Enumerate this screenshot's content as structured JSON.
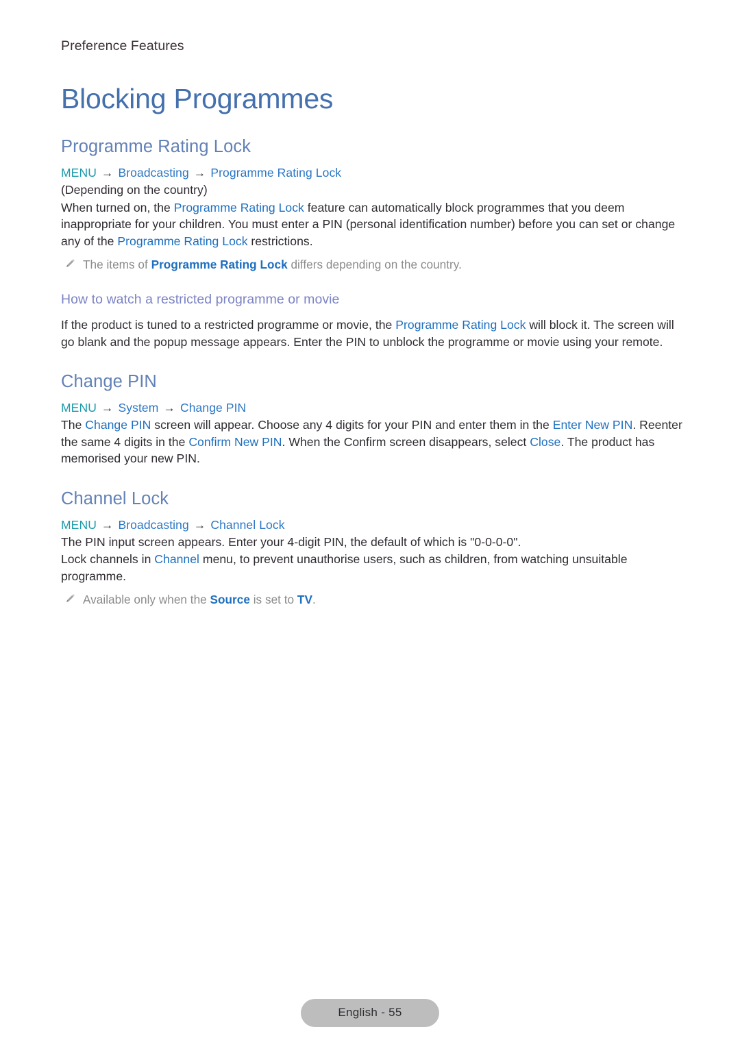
{
  "document": {
    "running_header": "Preference Features",
    "chapter_title": "Blocking Programmes",
    "page_badge": "English - 55"
  },
  "colors": {
    "chapter_title": "#4470ad",
    "section_title": "#6281b6",
    "subsection_title": "#7b83c4",
    "menu_root": "#1b9aaa",
    "menu_item": "#2a76c4",
    "inline_link": "#1d6fc0",
    "body_text": "#2f2b31",
    "note_text": "#8b8b8b",
    "badge_background": "#bdbdbd",
    "page_background": "#ffffff"
  },
  "icons": {
    "note": "pencil-icon",
    "arrow": "→"
  },
  "sections": [
    {
      "id": "programme-rating-lock",
      "title": "Programme Rating Lock",
      "menu_path": {
        "root": "MENU",
        "items": [
          "Broadcasting",
          "Programme Rating Lock"
        ]
      },
      "paragraphs": [
        {
          "id": "depending-country",
          "runs": [
            {
              "t": "(Depending on the country)",
              "s": "plain"
            }
          ]
        },
        {
          "id": "rating-lock-description",
          "runs": [
            {
              "t": "When turned on, the ",
              "s": "plain"
            },
            {
              "t": "Programme Rating Lock",
              "s": "link"
            },
            {
              "t": " feature can automatically block programmes that you deem inappropriate for your children. You must enter a PIN (personal identification number) before you can set or change any of the ",
              "s": "plain"
            },
            {
              "t": "Programme Rating Lock",
              "s": "link"
            },
            {
              "t": " restrictions.",
              "s": "plain"
            }
          ]
        }
      ],
      "notes": [
        {
          "id": "items-differ-note",
          "runs": [
            {
              "t": "The items of ",
              "s": "plain"
            },
            {
              "t": "Programme Rating Lock",
              "s": "link-bold"
            },
            {
              "t": " differs depending on the country.",
              "s": "plain"
            }
          ]
        }
      ],
      "subsections": [
        {
          "id": "how-to-watch-restricted",
          "title": "How to watch a restricted programme or movie",
          "paragraphs": [
            {
              "id": "how-to-watch-description",
              "runs": [
                {
                  "t": "If the product is tuned to a restricted programme or movie, the ",
                  "s": "plain"
                },
                {
                  "t": "Programme Rating Lock",
                  "s": "link"
                },
                {
                  "t": " will block it. The screen will go blank and the popup message appears. Enter the PIN to unblock the programme or movie using your remote.",
                  "s": "plain"
                }
              ]
            }
          ]
        }
      ]
    },
    {
      "id": "change-pin",
      "title": "Change PIN",
      "menu_path": {
        "root": "MENU",
        "items": [
          "System",
          "Change PIN"
        ]
      },
      "paragraphs": [
        {
          "id": "change-pin-description",
          "runs": [
            {
              "t": "The ",
              "s": "plain"
            },
            {
              "t": "Change PIN",
              "s": "link"
            },
            {
              "t": " screen will appear. Choose any 4 digits for your PIN and enter them in the ",
              "s": "plain"
            },
            {
              "t": "Enter New PIN",
              "s": "link"
            },
            {
              "t": ". Reenter the same 4 digits in the ",
              "s": "plain"
            },
            {
              "t": "Confirm New PIN",
              "s": "link"
            },
            {
              "t": ". When the Confirm screen disappears, select ",
              "s": "plain"
            },
            {
              "t": "Close",
              "s": "link"
            },
            {
              "t": ". The product has memorised your new PIN.",
              "s": "plain"
            }
          ]
        }
      ],
      "notes": [],
      "subsections": []
    },
    {
      "id": "channel-lock",
      "title": "Channel Lock",
      "menu_path": {
        "root": "MENU",
        "items": [
          "Broadcasting",
          "Channel Lock"
        ]
      },
      "paragraphs": [
        {
          "id": "pin-input-screen",
          "runs": [
            {
              "t": "The PIN input screen appears. Enter your 4-digit PIN, the default of which is \"0-0-0-0\".",
              "s": "plain"
            }
          ]
        },
        {
          "id": "lock-channels",
          "runs": [
            {
              "t": "Lock channels in ",
              "s": "plain"
            },
            {
              "t": "Channel",
              "s": "link"
            },
            {
              "t": " menu, to prevent unauthorise users, such as children, from watching unsuitable programme.",
              "s": "plain"
            }
          ]
        }
      ],
      "notes": [
        {
          "id": "source-tv-note",
          "runs": [
            {
              "t": "Available only when the ",
              "s": "plain"
            },
            {
              "t": "Source",
              "s": "link-bold"
            },
            {
              "t": " is set to ",
              "s": "plain"
            },
            {
              "t": "TV",
              "s": "link-bold"
            },
            {
              "t": ".",
              "s": "plain"
            }
          ]
        }
      ],
      "subsections": []
    }
  ]
}
